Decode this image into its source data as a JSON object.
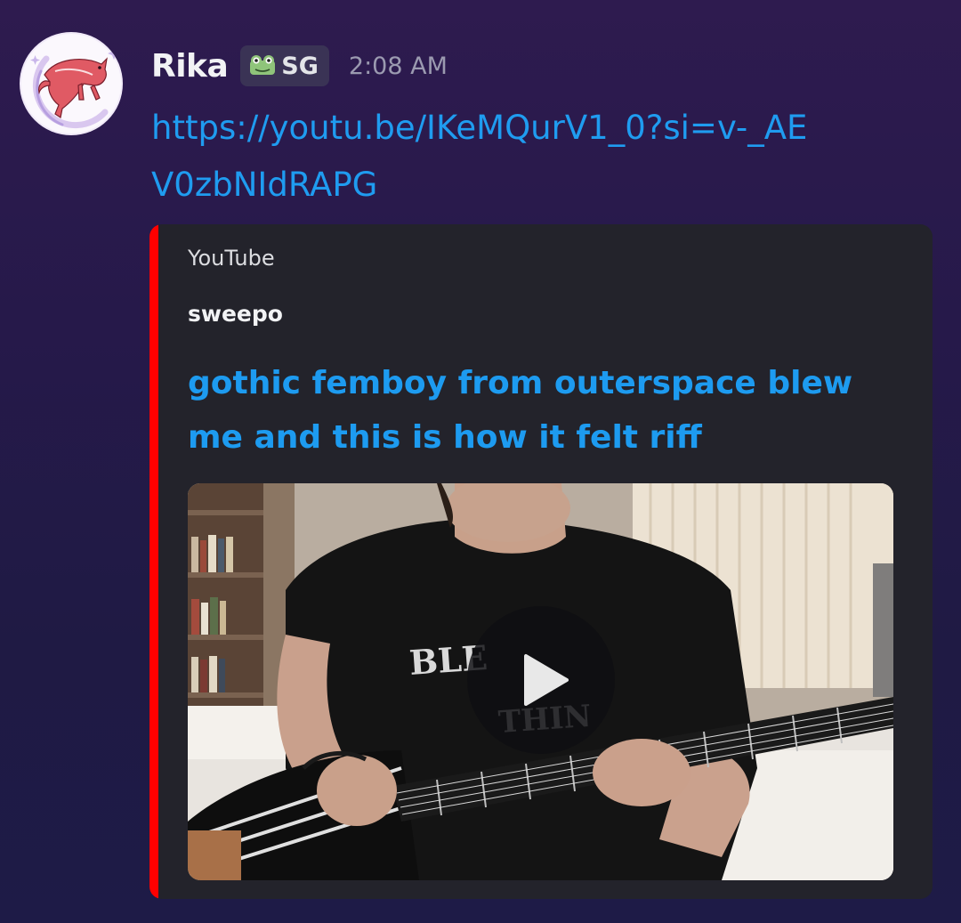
{
  "message": {
    "username": "Rika",
    "tag": "SG",
    "tag_icon": "frog-icon",
    "timestamp": "2:08 AM",
    "link": "https://youtu.be/IKeMQurV1_0?si=v-_AEV0zbNIdRAPG"
  },
  "embed": {
    "provider": "YouTube",
    "author": "sweepo",
    "title": "gothic femboy from outerspace blew me and this is how it felt riff",
    "accent_color": "#ff0000",
    "play_icon": "play-icon"
  },
  "colors": {
    "link": "#1f9cf0",
    "embed_background": "#23232b",
    "username": "#f2f3f5"
  }
}
